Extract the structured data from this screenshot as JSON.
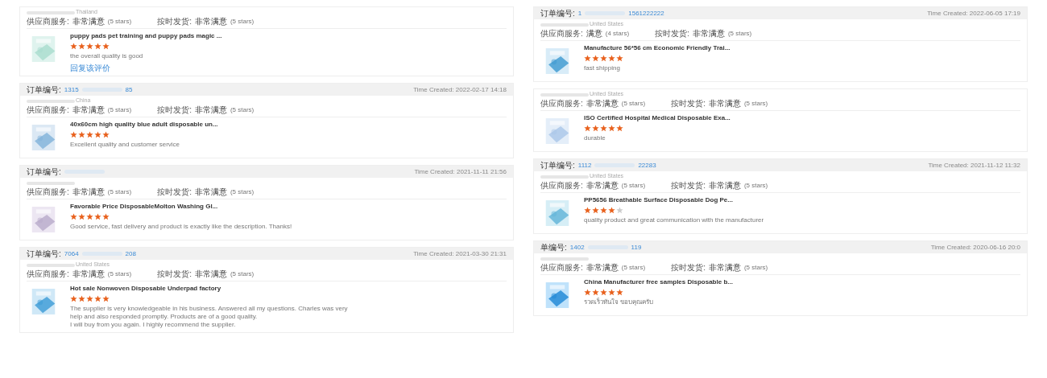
{
  "columns": [
    {
      "cards": [
        {
          "country": "Thailand",
          "ratings": [
            {
              "label": "供应商服务:",
              "value": "非常满意",
              "stars_text": "(5 stars)"
            },
            {
              "label": "按时发货:",
              "value": "非常满意",
              "stars_text": "(5 stars)"
            }
          ],
          "product": {
            "title": "puppy pads pet training and puppy pads magic ...",
            "stars": 5,
            "comment": "the overall quality is good",
            "link": "回复该评价"
          }
        },
        {
          "header": {
            "order_label": "订单编号:",
            "order_start": "1315",
            "order_end": "85",
            "time": "Time Created: 2022-02-17 14:18"
          },
          "country": "China",
          "ratings": [
            {
              "label": "供应商服务:",
              "value": "非常满意",
              "stars_text": "(5 stars)"
            },
            {
              "label": "按时发货:",
              "value": "非常满意",
              "stars_text": "(5 stars)"
            }
          ],
          "product": {
            "title": "40x60cm high quality blue adult disposable un...",
            "stars": 5,
            "comment": "Excellent quality and customer service"
          }
        },
        {
          "header": {
            "order_label": "订单编号:",
            "time": "Time Created: 2021-11-11 21:56"
          },
          "ratings": [
            {
              "label": "供应商服务:",
              "value": "非常满意",
              "stars_text": "(5 stars)"
            },
            {
              "label": "按时发货:",
              "value": "非常满意",
              "stars_text": "(5 stars)"
            }
          ],
          "product": {
            "title": "Favorable Price DisposableMolton Washing Gl...",
            "stars": 5,
            "comment": "Good service, fast delivery and product is exactly like the description. Thanks!"
          }
        },
        {
          "header": {
            "order_label": "订单编号:",
            "order_start": "7064",
            "order_end": "208",
            "time": "Time Created: 2021-03-30 21:31"
          },
          "country": "United States",
          "ratings": [
            {
              "label": "供应商服务:",
              "value": "非常满意",
              "stars_text": "(5 stars)"
            },
            {
              "label": "按时发货:",
              "value": "非常满意",
              "stars_text": "(5 stars)"
            }
          ],
          "product": {
            "title": "Hot sale Nonwoven Disposable Underpad factory",
            "stars": 5,
            "comment": "The supplier is very knowledgeable in his business. Answered all my questions. Charles was very help and also responded promptly. Products are of a good quality.\nI will buy from you again. I highly recommend the supplier."
          }
        }
      ]
    },
    {
      "cards": [
        {
          "header": {
            "order_label": "订单编号:",
            "order_start": "1",
            "order_end": "1561222222",
            "time": "Time Created: 2022-06-05 17:19"
          },
          "country": "United States",
          "ratings": [
            {
              "label": "供应商服务:",
              "value": "满意",
              "stars_text": "(4 stars)"
            },
            {
              "label": "按时发货:",
              "value": "非常满意",
              "stars_text": "(5 stars)"
            }
          ],
          "product": {
            "title": "Manufacture 56*56 cm Economic Friendly Trai...",
            "stars": 5,
            "comment": "fast shipping"
          }
        },
        {
          "country": "United States",
          "ratings": [
            {
              "label": "供应商服务:",
              "value": "非常满意",
              "stars_text": "(5 stars)"
            },
            {
              "label": "按时发货:",
              "value": "非常满意",
              "stars_text": "(5 stars)"
            }
          ],
          "product": {
            "title": "ISO Certified Hospital Medical Disposable Exa...",
            "stars": 5,
            "comment": "durable"
          }
        },
        {
          "header": {
            "order_label": "订单编号:",
            "order_start": "1112",
            "order_end": "22283",
            "time": "Time Created: 2021-11-12 11:32"
          },
          "country": "United States",
          "ratings": [
            {
              "label": "供应商服务:",
              "value": "非常满意",
              "stars_text": "(5 stars)"
            },
            {
              "label": "按时发货:",
              "value": "非常满意",
              "stars_text": "(5 stars)"
            }
          ],
          "product": {
            "title": "PP5656 Breathable Surface Disposable Dog Pe...",
            "stars": 4,
            "comment": "quality product and great communication with the manufacturer"
          }
        },
        {
          "header": {
            "order_label": "单编号:",
            "order_start": "1402",
            "order_end": "119",
            "time": "Time Created: 2020-06-16 20:0"
          },
          "ratings": [
            {
              "label": "供应商服务:",
              "value": "非常满意",
              "stars_text": "(5 stars)"
            },
            {
              "label": "按时发货:",
              "value": "非常满意",
              "stars_text": "(5 stars)"
            }
          ],
          "product": {
            "title": "China Manufacturer free samples Disposable b...",
            "stars": 5,
            "comment": "รวดเร็วทันใจ ขอบคุณครับ"
          }
        }
      ]
    }
  ]
}
